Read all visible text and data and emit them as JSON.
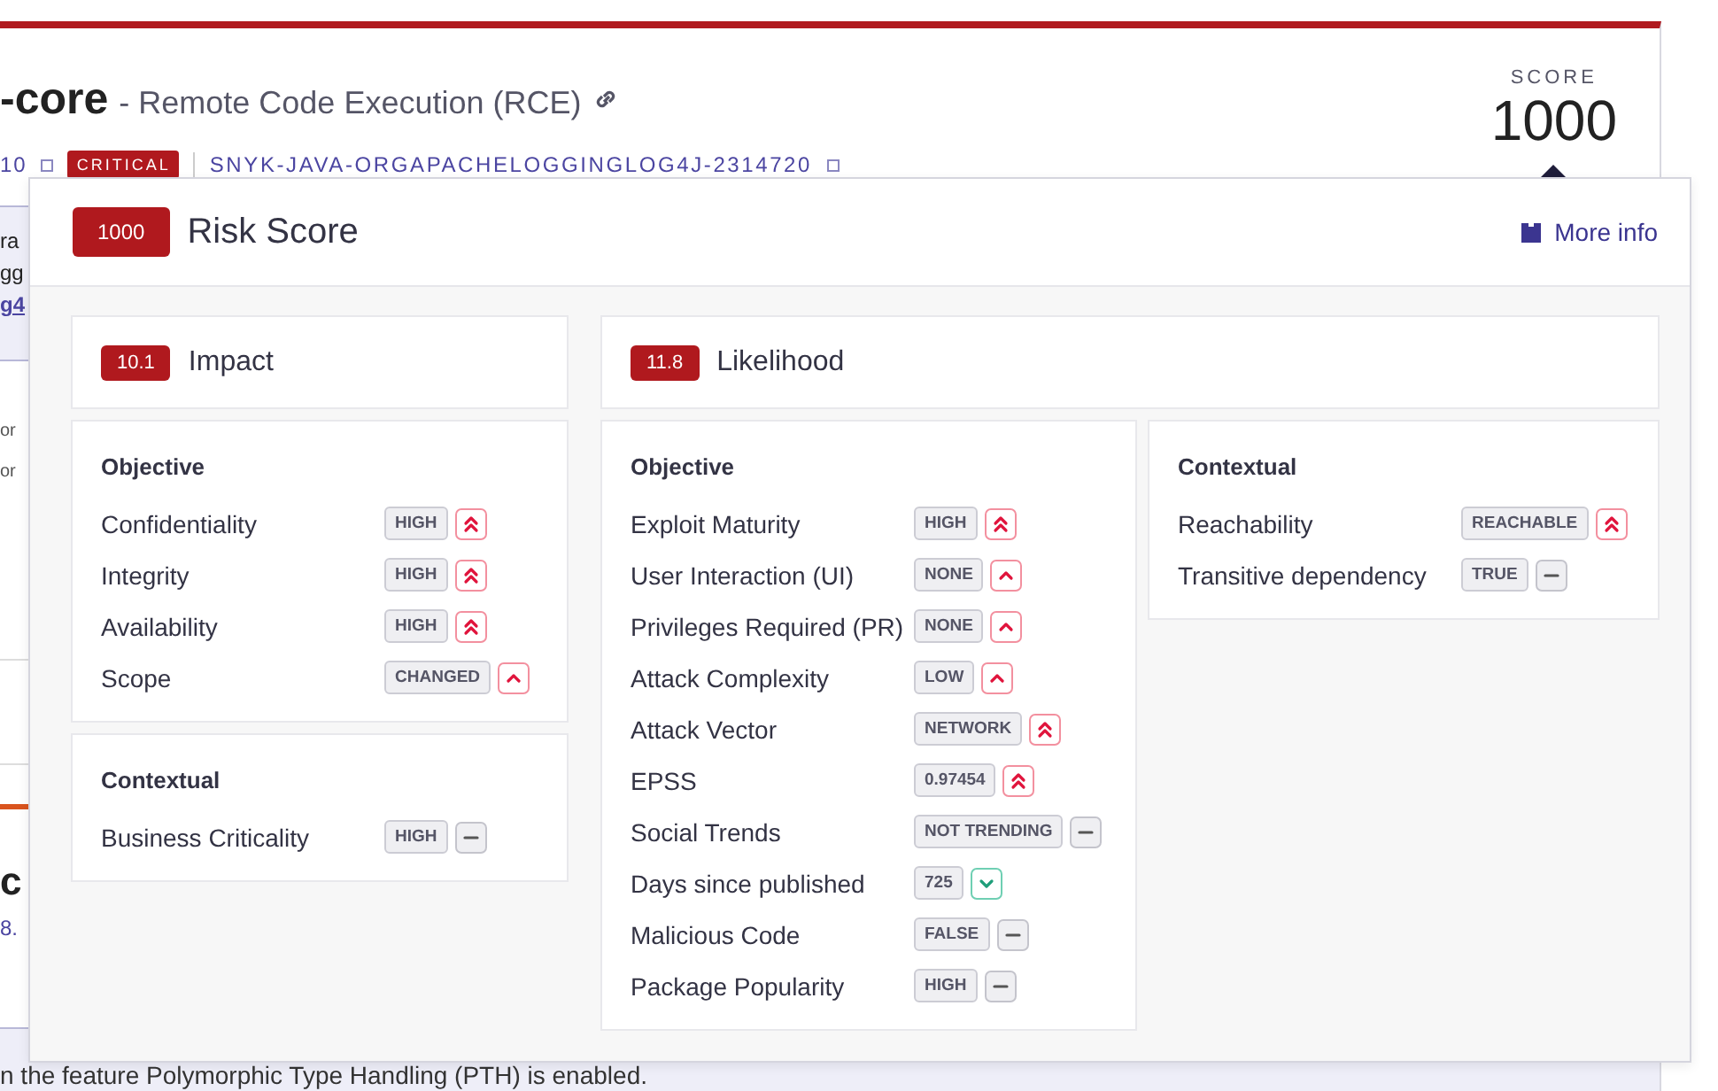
{
  "page": {
    "title": "-core",
    "subtitle": "- Remote Code Execution (RCE)",
    "version_fragment": "10",
    "severity": "CRITICAL",
    "vuln_id": "SNYK-JAVA-ORGAPACHELOGGINGLOG4J-2314720",
    "score_label": "SCORE",
    "score": "1000",
    "side_fragments": [
      {
        "kind": "panel_text",
        "text": "ra"
      },
      {
        "kind": "panel_text",
        "text": "gg"
      },
      {
        "kind": "panel_link",
        "text": "g4"
      },
      {
        "kind": "small",
        "text": "or"
      },
      {
        "kind": "small",
        "text": "or"
      },
      {
        "kind": "heading",
        "text": "c"
      },
      {
        "kind": "link",
        "text": "8."
      }
    ],
    "footer_text": "n the feature Polymorphic Type Handling (PTH) is enabled."
  },
  "popover": {
    "score": "1000",
    "title": "Risk Score",
    "more_info": "More info",
    "impact": {
      "score": "10.1",
      "title": "Impact",
      "groups": [
        {
          "title": "Objective",
          "rows": [
            {
              "label": "Confidentiality",
              "value": "HIGH",
              "kind": "double_up"
            },
            {
              "label": "Integrity",
              "value": "HIGH",
              "kind": "double_up"
            },
            {
              "label": "Availability",
              "value": "HIGH",
              "kind": "double_up"
            },
            {
              "label": "Scope",
              "value": "CHANGED",
              "kind": "up"
            }
          ]
        },
        {
          "title": "Contextual",
          "rows": [
            {
              "label": "Business Criticality",
              "value": "HIGH",
              "kind": "neutral"
            }
          ]
        }
      ]
    },
    "likelihood": {
      "score": "11.8",
      "title": "Likelihood",
      "groups": [
        {
          "title": "Objective",
          "rows": [
            {
              "label": "Exploit Maturity",
              "value": "HIGH",
              "kind": "double_up"
            },
            {
              "label": "User Interaction (UI)",
              "value": "NONE",
              "kind": "up"
            },
            {
              "label": "Privileges Required (PR)",
              "value": "NONE",
              "kind": "up"
            },
            {
              "label": "Attack Complexity",
              "value": "LOW",
              "kind": "up"
            },
            {
              "label": "Attack Vector",
              "value": "NETWORK",
              "kind": "double_up"
            },
            {
              "label": "EPSS",
              "value": "0.97454",
              "kind": "double_up"
            },
            {
              "label": "Social Trends",
              "value": "NOT TRENDING",
              "kind": "neutral"
            },
            {
              "label": "Days since published",
              "value": "725",
              "kind": "down"
            },
            {
              "label": "Malicious Code",
              "value": "FALSE",
              "kind": "neutral"
            },
            {
              "label": "Package Popularity",
              "value": "HIGH",
              "kind": "neutral"
            }
          ]
        },
        {
          "title": "Contextual",
          "rows": [
            {
              "label": "Reachability",
              "value": "REACHABLE",
              "kind": "double_up"
            },
            {
              "label": "Transitive dependency",
              "value": "TRUE",
              "kind": "neutral"
            }
          ]
        }
      ]
    }
  }
}
